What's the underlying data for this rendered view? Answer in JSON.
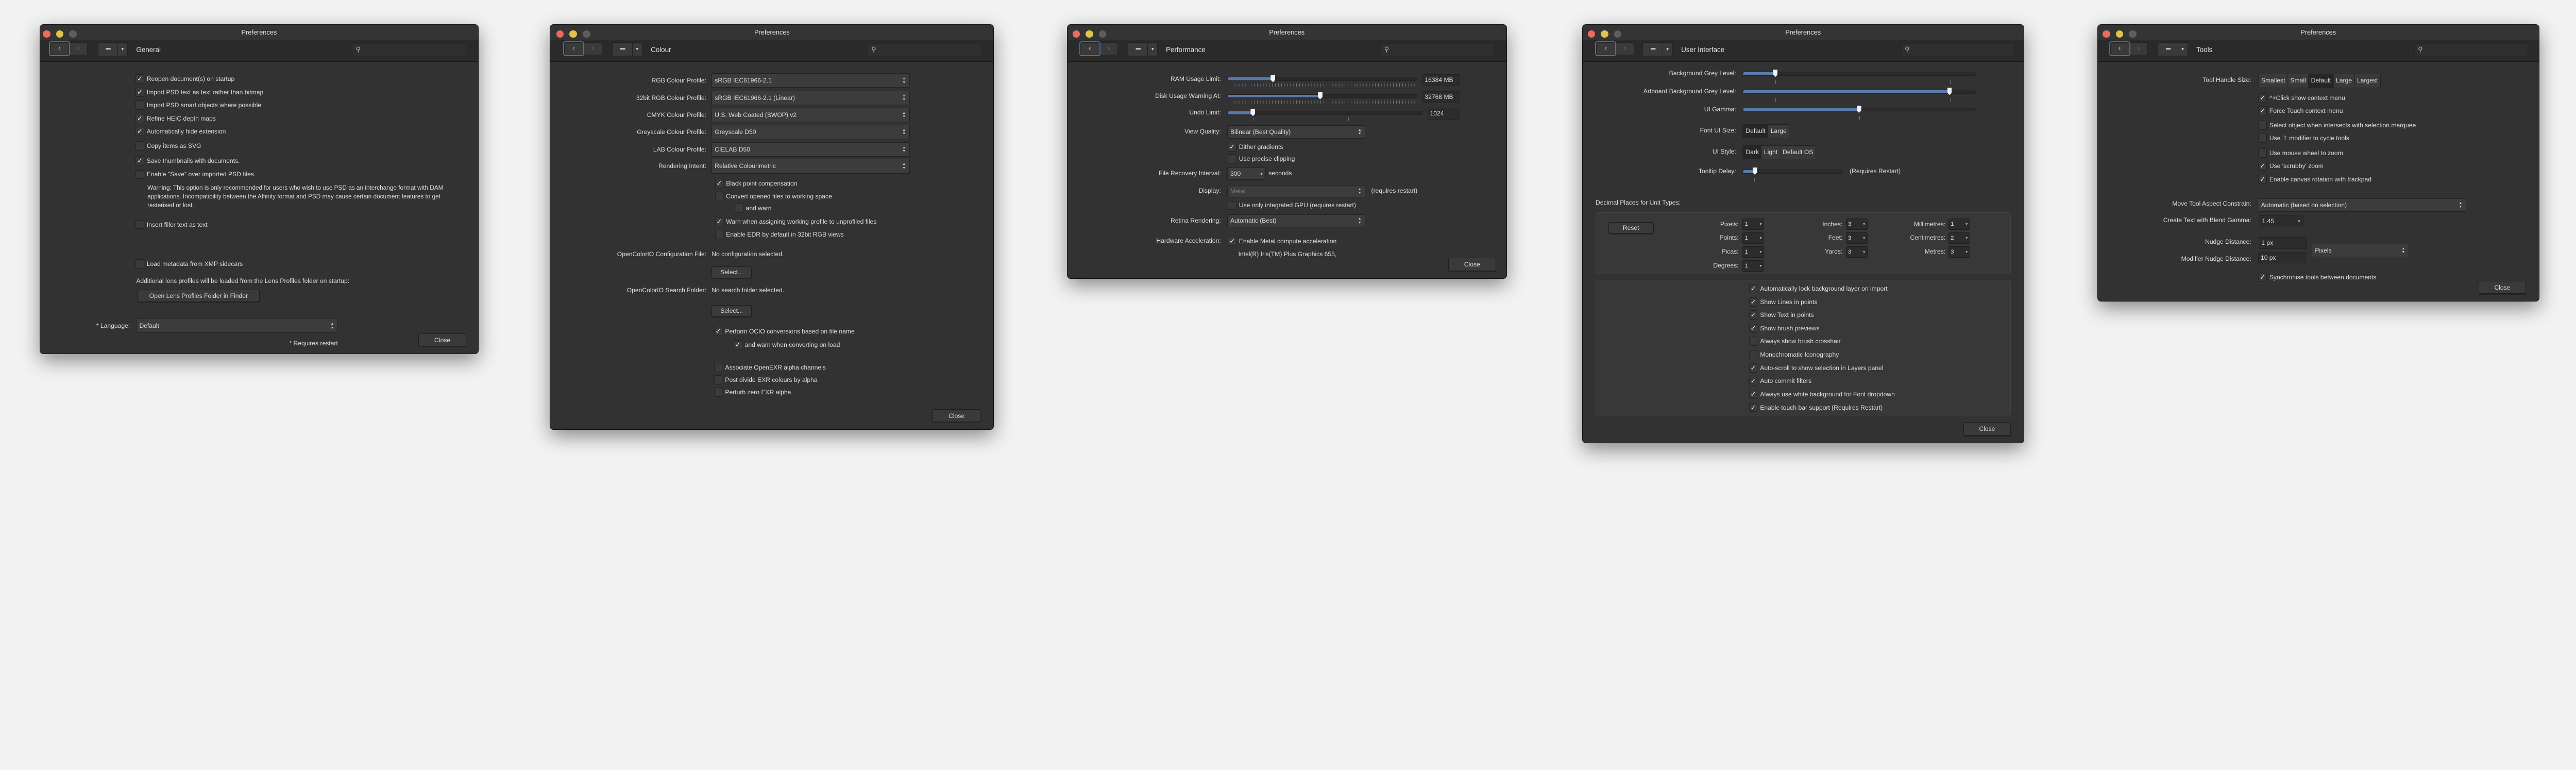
{
  "colors": {
    "close": "#ec6a5e",
    "minimize": "#e0c34a",
    "zoom": "#5e5e5e",
    "accent": "#3a74b0",
    "slider_fill": "#5a7aa8"
  },
  "common": {
    "window_title": "Preferences",
    "close_label": "Close",
    "back_icon": "‹",
    "forward_icon": "›",
    "grid_icon": "▪▪▪▪",
    "dropdown_icon": "▾",
    "search_icon": "⚲",
    "check": "✓"
  },
  "general": {
    "section": "General",
    "options": [
      {
        "label": "Reopen document(s) on startup",
        "checked": true
      },
      {
        "label": "Import PSD text as text rather than bitmap",
        "checked": true
      },
      {
        "label": "Import PSD smart objects where possible",
        "checked": false
      },
      {
        "label": "Refine HEIC depth maps",
        "checked": true
      },
      {
        "label": "Automatically hide extension",
        "checked": true
      },
      {
        "label": "Copy items as SVG",
        "checked": false
      },
      {
        "label": "Save thumbnails with documents.",
        "checked": true
      },
      {
        "label": "Enable \"Save\" over imported PSD files.",
        "checked": false
      },
      {
        "label": "Insert filler text as text",
        "checked": false
      },
      {
        "label": "Load metadata from XMP sidecars",
        "checked": false
      }
    ],
    "warning": "Warning: This option is only recommended for users who wish to use PSD as an interchange format with DAM applications. Incompatibility between the Affinity format and PSD may cause certain document features to get rasterised or lost.",
    "lens_text": "Additional lens profiles will be loaded from the Lens Profiles folder on startup:",
    "lens_button": "Open Lens Profiles Folder in Finder",
    "language_label": "* Language:",
    "language_value": "Default",
    "restart_note": "* Requires restart"
  },
  "colour": {
    "section": "Colour",
    "profiles": [
      {
        "label": "RGB Colour Profile:",
        "value": "sRGB IEC61966-2.1"
      },
      {
        "label": "32bit RGB Colour Profile:",
        "value": "sRGB IEC61966-2.1 (Linear)"
      },
      {
        "label": "CMYK Colour Profile:",
        "value": "U.S. Web Coated (SWOP) v2"
      },
      {
        "label": "Greyscale Colour Profile:",
        "value": "Greyscale D50"
      },
      {
        "label": "LAB Colour Profile:",
        "value": "CIELAB D50"
      },
      {
        "label": "Rendering Intent:",
        "value": "Relative Colourimetric"
      }
    ],
    "options": [
      {
        "label": "Black point compensation",
        "checked": true
      },
      {
        "label": "Convert opened files to working space",
        "checked": false
      },
      {
        "label": "and warn",
        "checked": false
      },
      {
        "label": "Warn when assigning working profile to unprofiled files",
        "checked": true
      },
      {
        "label": "Enable EDR by default in 32bit RGB views",
        "checked": false
      },
      {
        "label": "Perform OCIO conversions based on file name",
        "checked": true
      },
      {
        "label": "and warn when converting on load",
        "checked": true
      },
      {
        "label": "Associate OpenEXR alpha channels",
        "checked": false
      },
      {
        "label": "Post divide EXR colours by alpha",
        "checked": false
      },
      {
        "label": "Perturb zero EXR alpha",
        "checked": false
      }
    ],
    "ocio_config_label": "OpenColorIO Configuration File:",
    "ocio_config_value": "No configuration selected.",
    "ocio_folder_label": "OpenColorIO Search Folder:",
    "ocio_folder_value": "No search folder selected.",
    "select_label": "Select..."
  },
  "performance": {
    "section": "Performance",
    "ram_label": "RAM Usage Limit:",
    "ram_value": "16384 MB",
    "ram_fraction": 0.24,
    "disk_label": "Disk Usage Warning At:",
    "disk_value": "32768 MB",
    "disk_fraction": 0.49,
    "undo_label": "Undo Limit:",
    "undo_value": "1024",
    "undo_fraction": 0.13,
    "view_quality_label": "View Quality:",
    "view_quality_value": "Bilinear (Best Quality)",
    "dither_label": "Dither gradients",
    "dither_checked": true,
    "clipping_label": "Use precise clipping",
    "clipping_checked": false,
    "recovery_label": "File Recovery Interval:",
    "recovery_value": "300",
    "recovery_unit": "seconds",
    "display_label": "Display:",
    "display_value": "Metal",
    "display_note": "(requires restart)",
    "gpu_label": "Use only integrated GPU (requires restart)",
    "gpu_checked": false,
    "retina_label": "Retina Rendering:",
    "retina_value": "Automatic (Best)",
    "hw_label": "Hardware Acceleration:",
    "hw_option": "Enable Metal compute acceleration",
    "hw_checked": true,
    "gpu_name": "Intel(R) Iris(TM) Plus Graphics 655,"
  },
  "ui": {
    "section": "User Interface",
    "bg_label": "Background Grey Level:",
    "bg_fraction": 0.14,
    "artboard_label": "Artboard Background Grey Level:",
    "artboard_fraction": 0.89,
    "gamma_label": "UI Gamma:",
    "gamma_fraction": 0.5,
    "font_label": "Font UI Size:",
    "font_options": [
      "Default",
      "Large"
    ],
    "font_selected": "Default",
    "style_label": "UI Style:",
    "style_options": [
      "Dark",
      "Light",
      "Default OS"
    ],
    "style_selected": "Dark",
    "tooltip_label": "Tooltip Delay:",
    "tooltip_fraction": 0.12,
    "tooltip_note": "(Requires Restart)",
    "decimal_header": "Decimal Places for Unit Types:",
    "reset_label": "Reset",
    "units": [
      {
        "label": "Pixels:",
        "value": "1"
      },
      {
        "label": "Points:",
        "value": "1"
      },
      {
        "label": "Picas:",
        "value": "1"
      },
      {
        "label": "Degrees:",
        "value": "1"
      },
      {
        "label": "Inches:",
        "value": "3"
      },
      {
        "label": "Feet:",
        "value": "3"
      },
      {
        "label": "Yards:",
        "value": "3"
      },
      {
        "label": "Millimetres:",
        "value": "1"
      },
      {
        "label": "Centimetres:",
        "value": "2"
      },
      {
        "label": "Metres:",
        "value": "3"
      }
    ],
    "options": [
      {
        "label": "Automatically lock background layer on import",
        "checked": true
      },
      {
        "label": "Show Lines in points",
        "checked": true
      },
      {
        "label": "Show Text in points",
        "checked": true
      },
      {
        "label": "Show brush previews",
        "checked": true
      },
      {
        "label": "Always show brush crosshair",
        "checked": false
      },
      {
        "label": "Monochromatic Iconography",
        "checked": false
      },
      {
        "label": "Auto-scroll to show selection in Layers panel",
        "checked": true
      },
      {
        "label": "Auto commit filters",
        "checked": true
      },
      {
        "label": "Always use white background for Font dropdown",
        "checked": true
      },
      {
        "label": "Enable touch bar support (Requires Restart)",
        "checked": true
      }
    ]
  },
  "tools": {
    "section": "Tools",
    "handle_label": "Tool Handle Size:",
    "handle_options": [
      "Smallest",
      "Small",
      "Default",
      "Large",
      "Largest"
    ],
    "handle_selected": "Default",
    "options": [
      {
        "label": "^+Click show context menu",
        "checked": true
      },
      {
        "label": "Force Touch context menu",
        "checked": true
      },
      {
        "label": "Select object when intersects with selection marquee",
        "checked": false
      },
      {
        "label": "Use ⇧ modifier to cycle tools",
        "checked": false
      },
      {
        "label": "Use mouse wheel to zoom",
        "checked": false
      },
      {
        "label": "Use 'scrubby' zoom",
        "checked": true
      },
      {
        "label": "Enable canvas rotation with trackpad",
        "checked": true
      },
      {
        "label": "Synchronise tools between documents",
        "checked": true
      }
    ],
    "aspect_label": "Move Tool Aspect Constrain:",
    "aspect_value": "Automatic (based on selection)",
    "gamma_label": "Create Text with Blend Gamma:",
    "gamma_value": "1.45",
    "nudge_label": "Nudge Distance:",
    "nudge_value": "1 px",
    "mod_nudge_label": "Modifier Nudge Distance:",
    "mod_nudge_value": "10 px",
    "unit_value": "Pixels"
  }
}
